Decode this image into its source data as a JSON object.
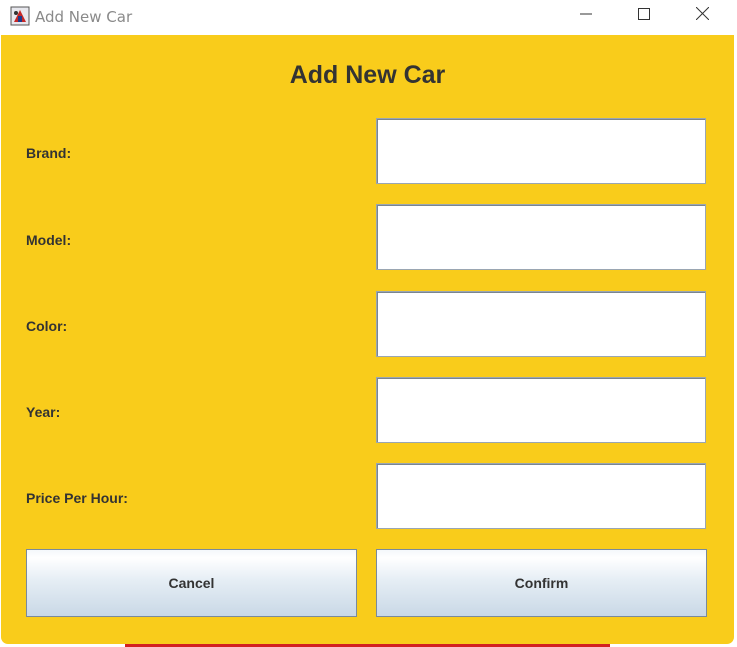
{
  "window": {
    "title": "Add New Car",
    "app_icon": "java-app-icon",
    "controls": {
      "minimize_icon": "minimize-icon",
      "maximize_icon": "maximize-icon",
      "close_icon": "close-icon"
    }
  },
  "form": {
    "heading": "Add New Car",
    "background_color": "#f9cc1b",
    "fields": [
      {
        "label": "Brand:",
        "value": "",
        "placeholder": ""
      },
      {
        "label": "Model:",
        "value": "",
        "placeholder": ""
      },
      {
        "label": "Color:",
        "value": "",
        "placeholder": ""
      },
      {
        "label": "Year:",
        "value": "",
        "placeholder": ""
      },
      {
        "label": "Price Per Hour:",
        "value": "",
        "placeholder": ""
      }
    ],
    "buttons": {
      "cancel_label": "Cancel",
      "confirm_label": "Confirm"
    }
  }
}
